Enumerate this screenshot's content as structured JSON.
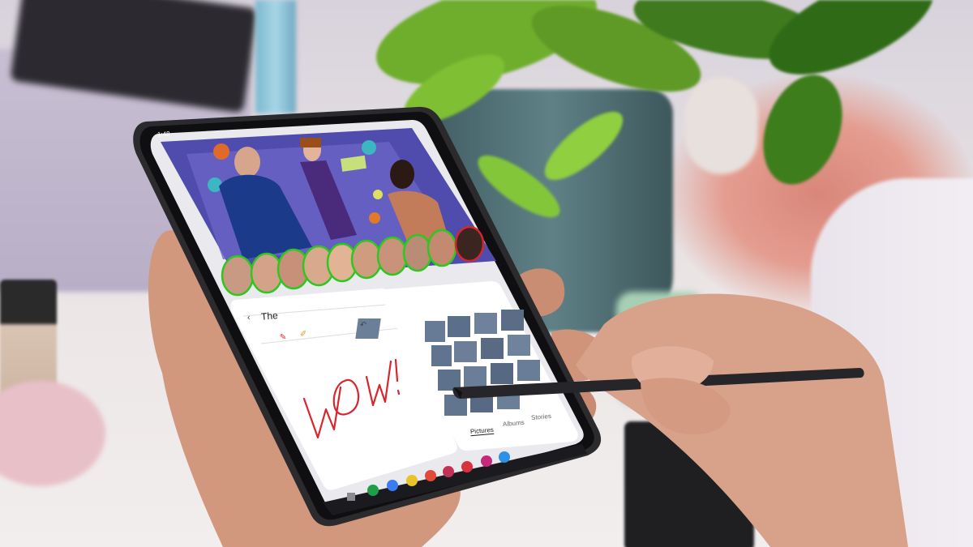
{
  "status_bar": {
    "time": "1:48"
  },
  "notes_app": {
    "note_title": "The",
    "handwriting": "Wow!"
  },
  "gallery_app": {
    "tabs": [
      "Pictures",
      "Albums",
      "Stories"
    ],
    "active_tab": "Pictures"
  },
  "colors": {
    "ink_red": "#d8262c",
    "face_outline_green": "#2ec71f",
    "face_outline_red": "#d8262c",
    "screen_bg": "#e9e9ee"
  },
  "dock": {
    "app_icons": [
      "phone-icon",
      "messages-icon",
      "chrome-icon",
      "camera-icon",
      "slack-icon",
      "photos-icon",
      "gallery-icon",
      "bixby-icon"
    ]
  }
}
